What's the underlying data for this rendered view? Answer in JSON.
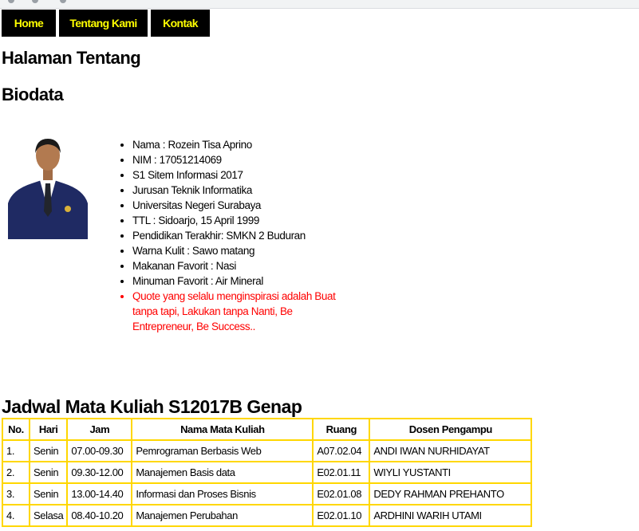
{
  "nav": {
    "items": [
      {
        "label": "Home"
      },
      {
        "label": "Tentang Kami"
      },
      {
        "label": "Kontak"
      }
    ]
  },
  "page_title": "Halaman Tentang",
  "section_title": "Biodata",
  "biodata": {
    "items": [
      "Nama : Rozein Tisa Aprino",
      "NIM : 17051214069",
      "S1 Sitem Informasi 2017",
      "Jurusan Teknik Informatika",
      "Universitas Negeri Surabaya",
      "TTL : Sidoarjo, 15 April 1999",
      "Pendidikan Terakhir: SMKN 2 Buduran",
      "Warna Kulit : Sawo matang",
      "Makanan Favorit : Nasi",
      "Minuman Favorit : Air Mineral"
    ],
    "quote": "Quote yang selalu menginspirasi adalah Buat tanpa tapi, Lakukan tanpa Nanti, Be Entrepreneur, Be Success..",
    "quote_color": "#ff0000"
  },
  "schedule": {
    "title": "Jadwal Mata Kuliah S12017B Genap",
    "headers": [
      "No.",
      "Hari",
      "Jam",
      "Nama Mata Kuliah",
      "Ruang",
      "Dosen Pengampu"
    ],
    "rows": [
      [
        "1.",
        "Senin",
        "07.00-09.30",
        "Pemrograman Berbasis Web",
        "A07.02.04",
        "ANDI IWAN NURHIDAYAT"
      ],
      [
        "2.",
        "Senin",
        "09.30-12.00",
        "Manajemen Basis data",
        "E02.01.11",
        "WIYLI YUSTANTI"
      ],
      [
        "3.",
        "Senin",
        "13.00-14.40",
        "Informasi dan Proses Bisnis",
        "E02.01.08",
        "DEDY RAHMAN PREHANTO"
      ],
      [
        "4.",
        "Selasa",
        "08.40-10.20",
        "Manajemen Perubahan",
        "E02.01.10",
        "ARDHINI WARIH UTAMI"
      ]
    ]
  },
  "colors": {
    "nav_bg": "#000000",
    "nav_text": "#ffff00",
    "table_border": "#ffd700"
  }
}
